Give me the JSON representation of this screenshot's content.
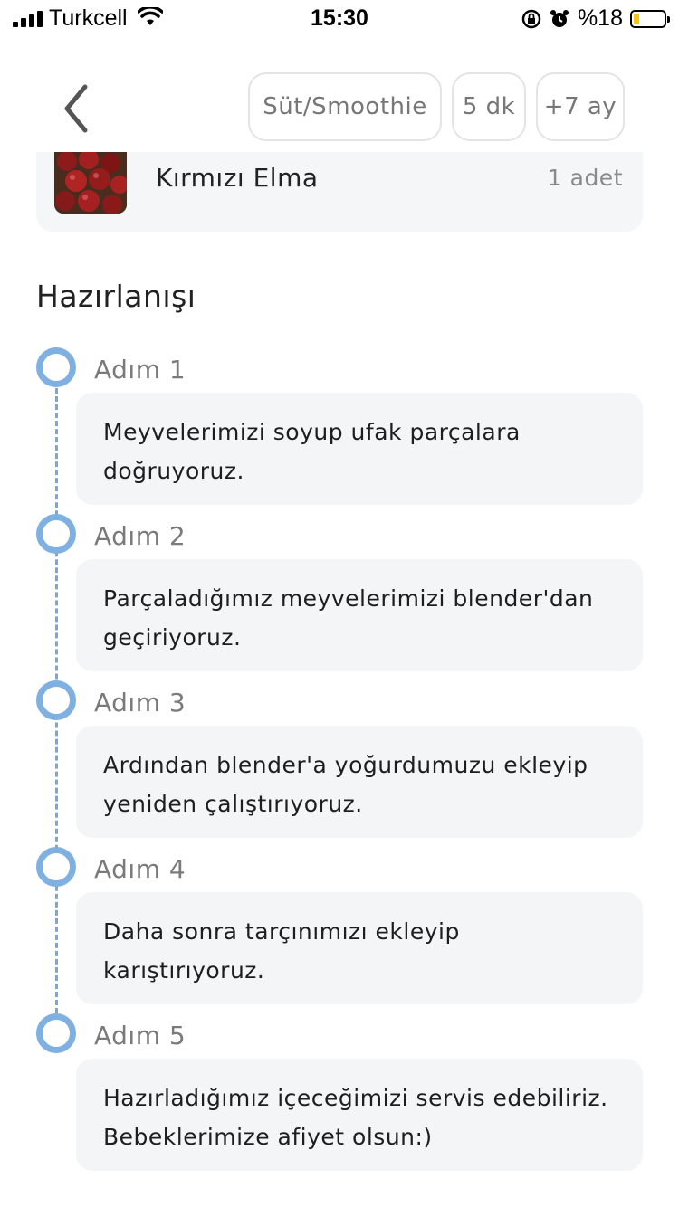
{
  "status_bar": {
    "carrier": "Turkcell",
    "time": "15:30",
    "battery_text": "%18",
    "battery_level": 0.18,
    "battery_color": "#f5c518"
  },
  "header": {
    "back_icon": "chevron-left-icon",
    "chips": [
      "Süt/Smoothie",
      "5 dk",
      "+7 ay"
    ]
  },
  "ingredient": {
    "name": "Kırmızı Elma",
    "quantity": "1 adet",
    "thumbnail": "red-apples-image"
  },
  "preparation": {
    "title": "Hazırlanışı",
    "accent_color": "#7fb0e2",
    "steps": [
      {
        "label": "Adım 1",
        "text": "Meyvelerimizi soyup ufak parçalara doğruyoruz."
      },
      {
        "label": "Adım 2",
        "text": "Parçaladığımız meyvelerimizi blender'dan geçiriyoruz."
      },
      {
        "label": "Adım 3",
        "text": "Ardından blender'a yoğurdumuzu ekleyip yeniden çalıştırıyoruz."
      },
      {
        "label": "Adım 4",
        "text": "Daha sonra tarçınımızı ekleyip karıştırıyoruz."
      },
      {
        "label": "Adım 5",
        "text": "Hazırladığımız içeceğimizi servis edebiliriz. Bebeklerimize afiyet olsun:)"
      }
    ]
  }
}
